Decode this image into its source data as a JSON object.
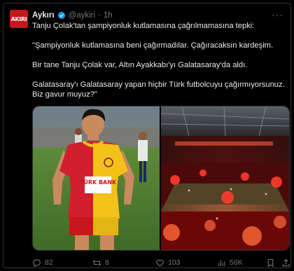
{
  "author": {
    "avatar_text": "AKIRI",
    "name": "Aykırı",
    "handle": "@aykiri",
    "separator": "·",
    "time": "1h"
  },
  "tweet": {
    "line1": "Tanju Çolak'tan şampiyonluk kutlamasına çağrılmamasına tepki:",
    "line2": "\"Şampiyonluk kutlamasına beni çağırmadılar. Çağıracaksın kardeşim.",
    "line3": "Bir tane Tanju Çolak var, Altın Ayakkabı'yı Galatasaray'da aldı.",
    "line4": "Galatasaray'ı Galatasaray yapan hiçbir Türk futbolcuyu çağırmıyorsunuz. Biz gavur muyuz?\""
  },
  "media": {
    "left_jersey_text": "TÜRK BANK"
  },
  "actions": {
    "replies": "82",
    "reposts": "8",
    "likes": "103",
    "views": "56K"
  },
  "colors": {
    "background": "#000000",
    "text": "#e7e9ea",
    "muted": "#71767b",
    "border": "#2f3336",
    "verified": "#1d9bf0",
    "avatar": "#c8161d"
  }
}
